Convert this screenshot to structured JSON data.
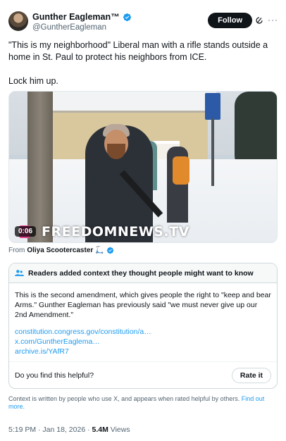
{
  "author": {
    "display_name": "Gunther Eagleman™",
    "handle": "@GuntherEagleman",
    "verified_color": "#1d9bf0"
  },
  "actions": {
    "follow_label": "Follow",
    "grok_icon": "grok-icon",
    "more_icon": "more-icon"
  },
  "tweet": {
    "paragraph_1": "\"This is my neighborhood\" Liberal man with a rifle stands outside a home in St. Paul to protect his neighbors from ICE.",
    "paragraph_2": "Lock him up."
  },
  "media": {
    "duration": "0:06",
    "watermark": "FREEDOMNEWS.TV"
  },
  "source": {
    "prefix": "From",
    "name": "Oliya Scootercaster",
    "emoji": "🛴"
  },
  "community_note": {
    "header": "Readers added context they thought people might want to know",
    "body": "This is the second amendment, which gives people the right to \"keep and bear Arms.\" Gunther Eagleman has previously said \"we must never give up our 2nd Amendment.\"",
    "links": [
      "constitution.congress.gov/constitution/a…",
      "x.com/GuntherEaglema…",
      "archive.is/YAfR7"
    ],
    "helpful_question": "Do you find this helpful?",
    "rate_label": "Rate it"
  },
  "footnote": {
    "text": "Context is written by people who use X, and appears when rated helpful by others.",
    "find_out_more": "Find out more."
  },
  "meta": {
    "timestamp": "5:19 PM · Jan 18, 2026",
    "separator": "·",
    "views_count": "5.4M",
    "views_label": "Views"
  }
}
